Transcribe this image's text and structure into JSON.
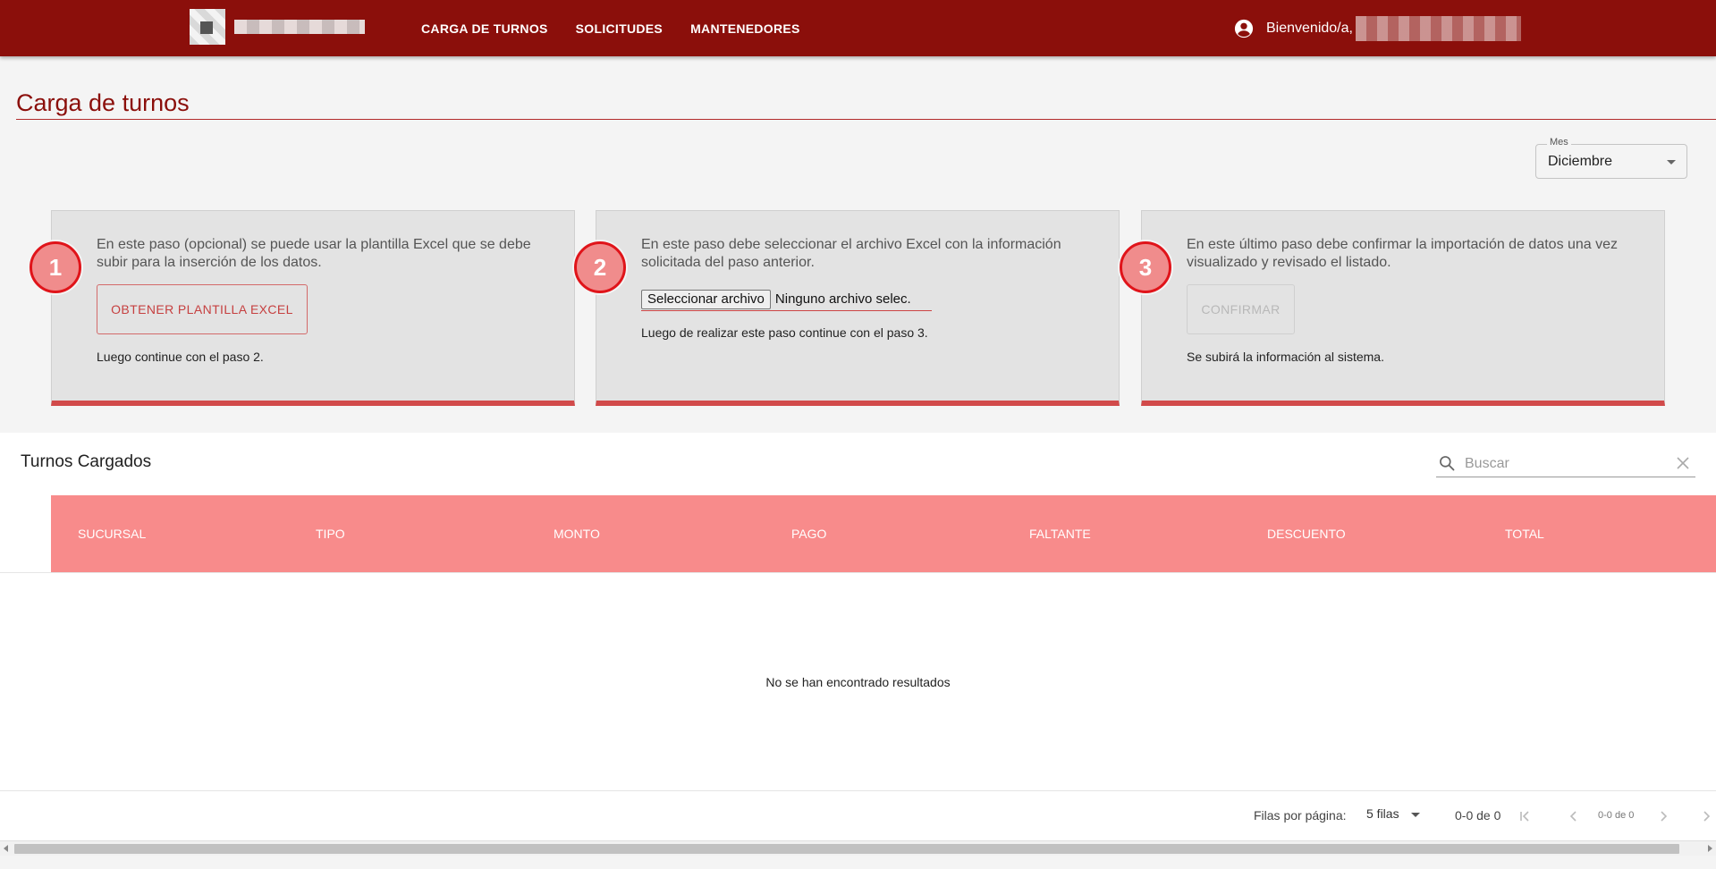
{
  "nav": {
    "items": [
      "CARGA DE TURNOS",
      "SOLICITUDES",
      "MANTENEDORES"
    ],
    "welcome": "Bienvenido/a,"
  },
  "page": {
    "title": "Carga de turnos"
  },
  "month": {
    "label": "Mes",
    "value": "Diciembre"
  },
  "steps": [
    {
      "number": "1",
      "text": "En este paso (opcional) se puede usar la plantilla Excel que se debe subir para la inserción de los datos.",
      "button": "OBTENER PLANTILLA EXCEL",
      "note": "Luego continue con el paso 2."
    },
    {
      "number": "2",
      "text": "En este paso debe seleccionar el archivo Excel con la información solicitada del paso anterior.",
      "file_button": "Seleccionar archivo",
      "file_name": "Ninguno archivo selec.",
      "note": "Luego de realizar este paso continue con el paso 3."
    },
    {
      "number": "3",
      "text": "En este último paso debe confirmar la importación de datos una vez visualizado y revisado el listado.",
      "button": "CONFIRMAR",
      "note": "Se subirá la información al sistema."
    }
  ],
  "table": {
    "title": "Turnos Cargados",
    "search_placeholder": "Buscar",
    "columns": [
      "SUCURSAL",
      "TIPO",
      "MONTO",
      "PAGO",
      "FALTANTE",
      "DESCUENTO",
      "TOTAL"
    ],
    "empty": "No se han encontrado resultados"
  },
  "pagination": {
    "rows_label": "Filas por página:",
    "rows_value": "5 filas",
    "range": "0-0 de 0",
    "range_small": "0-0 de 0"
  },
  "colors": {
    "topbar": "#8b0f0b",
    "header_row": "#f88b8b",
    "accent": "#d14a4a",
    "step_circle": "#f08c8c"
  }
}
